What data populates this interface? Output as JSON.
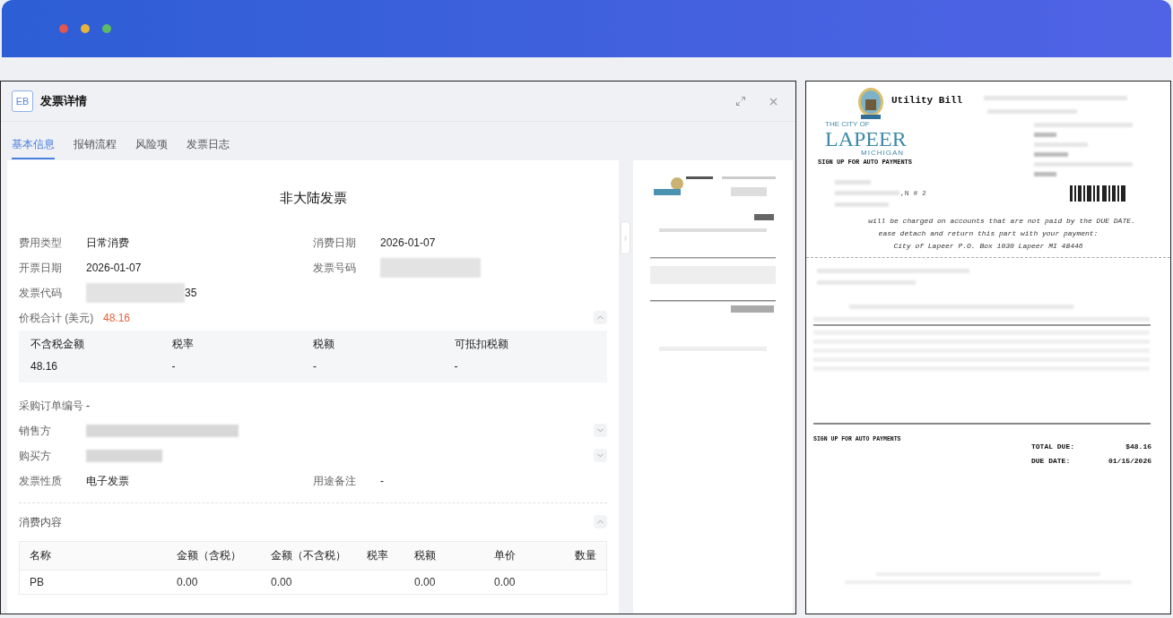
{
  "window": {
    "controls": [
      {
        "color": "#e0574f"
      },
      {
        "color": "#e7b53c"
      },
      {
        "color": "#5dbb63"
      }
    ]
  },
  "panel": {
    "badge": "EB",
    "title": "发票详情"
  },
  "tabs": [
    {
      "label": "基本信息",
      "selected": true
    },
    {
      "label": "报销流程",
      "selected": false
    },
    {
      "label": "风险项",
      "selected": false
    },
    {
      "label": "发票日志",
      "selected": false
    }
  ],
  "invoice": {
    "heading": "非大陆发票",
    "field_rows": [
      [
        {
          "label": "费用类型",
          "value": "日常消费"
        },
        {
          "label": "消费日期",
          "value": "2026-01-07"
        }
      ],
      [
        {
          "label": "开票日期",
          "value": "2026-01-07"
        },
        {
          "label": "发票号码",
          "redacted": true
        }
      ],
      [
        {
          "label": "发票代码",
          "value": "35",
          "redacted": true
        }
      ]
    ],
    "total": {
      "label": "价税合计 (美元)",
      "value": "48.16",
      "expanded": true
    },
    "tax_table": {
      "columns": [
        "不含税金额",
        "税率",
        "税额",
        "可抵扣税额"
      ],
      "values": [
        "48.16",
        "-",
        "-",
        "-"
      ]
    },
    "parties": [
      {
        "label": "采购订单编号",
        "value": "-"
      },
      {
        "label": "销售方",
        "redacted": true,
        "expanded": false
      },
      {
        "label": "购买方",
        "redacted": true,
        "expanded": false
      }
    ],
    "bottom_row": [
      {
        "label": "发票性质",
        "value": "电子发票"
      },
      {
        "label": "用途备注",
        "value": "-"
      }
    ]
  },
  "items": {
    "title": "消费内容",
    "expanded": true,
    "columns": [
      "名称",
      "金额（含税）",
      "金额（不含税）",
      "税率",
      "税额",
      "单价",
      "数量"
    ],
    "rows": [
      [
        "PB",
        "0.00",
        "0.00",
        null,
        "0.00",
        "0.00",
        null
      ]
    ]
  },
  "document": {
    "title": "Utility Bill",
    "logo": {
      "top": "THE CITY OF",
      "name": "LAPEER",
      "bottom": "MICHIGAN"
    },
    "promo": "SIGN UP FOR AUTO PAYMENTS",
    "address_tail": ",N # 2",
    "notice": "will be charged on accounts that are not paid by the DUE DATE.",
    "detach": "ease detach and return this part with your payment:",
    "remit": "City of Lapeer P.O. Box 1030 Lapeer MI 48446",
    "stub_promo": "SIGN UP FOR AUTO PAYMENTS",
    "totals": [
      {
        "label": "TOTAL DUE:",
        "value": "$48.16"
      },
      {
        "label": "DUE DATE:",
        "value": "01/15/2026"
      }
    ]
  }
}
